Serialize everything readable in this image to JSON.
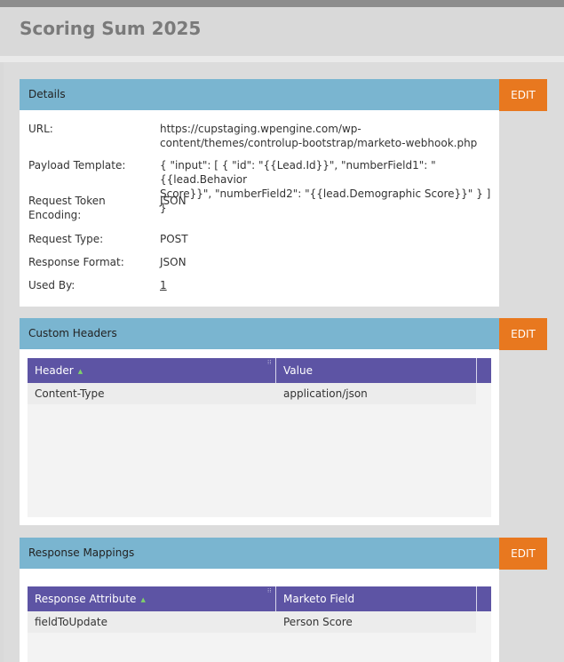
{
  "page": {
    "title": "Scoring Sum 2025"
  },
  "details": {
    "title": "Details",
    "edit_label": "EDIT",
    "fields": {
      "url": {
        "label": "URL:",
        "value_line1": "https://cupstaging.wpengine.com/wp-",
        "value_line2": "content/themes/controlup-bootstrap/marketo-webhook.php"
      },
      "payload": {
        "label": "Payload Template:",
        "value_line1": "{ \"input\": [ { \"id\": \"{{Lead.Id}}\", \"numberField1\": \"{{lead.Behavior",
        "value_line2": "Score}}\", \"numberField2\": \"{{lead.Demographic Score}}\" } ] }"
      },
      "encoding": {
        "label_line1": "Request Token",
        "label_line2": "Encoding:",
        "value": "JSON"
      },
      "request_type": {
        "label": "Request Type:",
        "value": "POST"
      },
      "response_format": {
        "label": "Response Format:",
        "value": "JSON"
      },
      "used_by": {
        "label": "Used By:",
        "value": "1"
      }
    }
  },
  "custom_headers": {
    "title": "Custom Headers",
    "edit_label": "EDIT",
    "columns": [
      "Header",
      "Value"
    ],
    "rows": [
      {
        "header": "Content-Type",
        "value": "application/json"
      }
    ]
  },
  "response_mappings": {
    "title": "Response Mappings",
    "edit_label": "EDIT",
    "columns": [
      "Response Attribute",
      "Marketo Field"
    ],
    "rows": [
      {
        "attribute": "fieldToUpdate",
        "field": "Person Score"
      }
    ]
  },
  "colors": {
    "panel_header": "#7ab5d0",
    "edit_button": "#e8781f",
    "grid_header": "#5d54a4",
    "sort_indicator": "#7fd16a"
  },
  "icons": {
    "sort": "sort-asc-icon",
    "column_resize": "column-grip-icon"
  }
}
